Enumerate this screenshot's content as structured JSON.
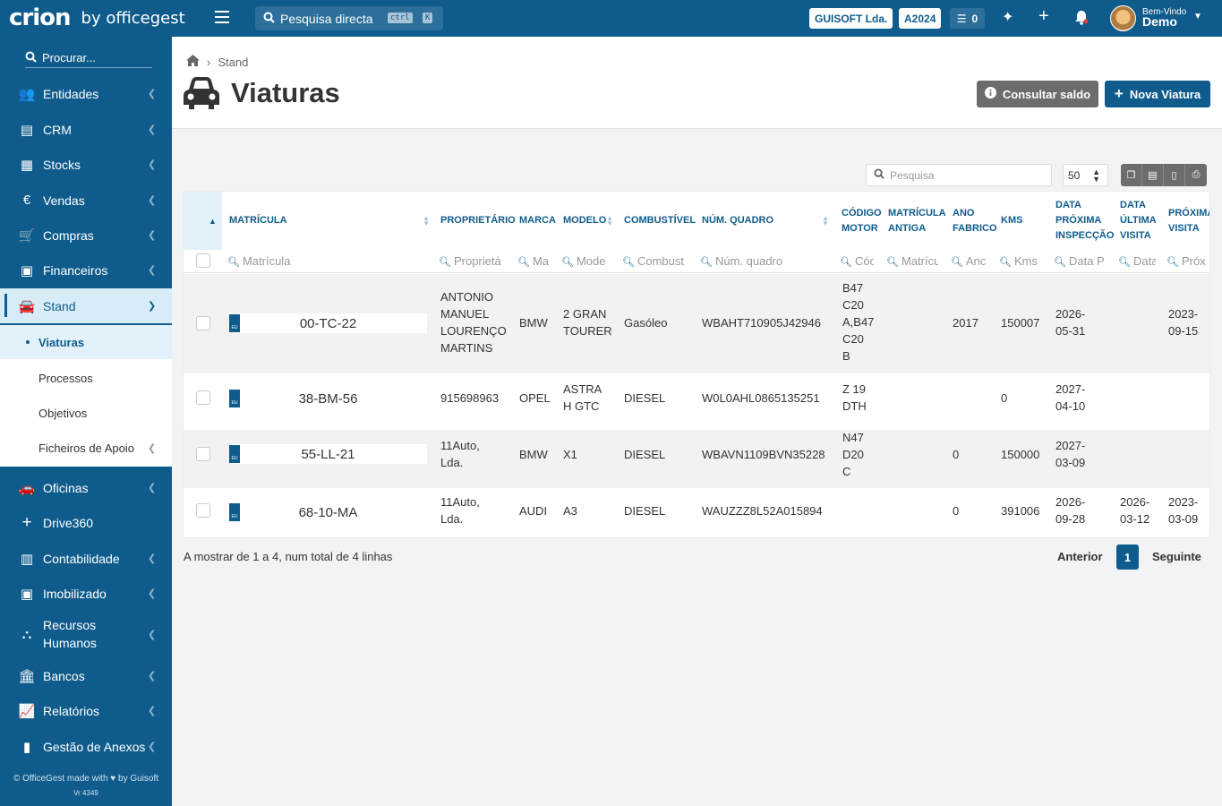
{
  "topbar": {
    "logo": "crion",
    "logo_by": "by officegest",
    "quick_search_placeholder": "Pesquisa directa",
    "kbd_ctrl": "ctrl",
    "kbd_k": "K",
    "company": "GUISOFT Lda.",
    "year": "A2024",
    "tasks_count": "0",
    "welcome_line1": "Bem-Vindo",
    "welcome_line2": "Demo",
    "icons": [
      "menu-icon",
      "search-icon",
      "tasks-icon",
      "sparkle-icon",
      "plus-icon",
      "bell-icon",
      "chevron-down-icon"
    ],
    "brand_color": "#0f5c8c"
  },
  "sidebar": {
    "search_placeholder": "Procurar...",
    "items": [
      {
        "label": "Entidades",
        "icon": "users-icon"
      },
      {
        "label": "CRM",
        "icon": "address-book-icon"
      },
      {
        "label": "Stocks",
        "icon": "warehouse-icon"
      },
      {
        "label": "Vendas",
        "icon": "euro-icon"
      },
      {
        "label": "Compras",
        "icon": "cart-icon"
      },
      {
        "label": "Financeiros",
        "icon": "money-icon"
      },
      {
        "label": "Stand",
        "icon": "cars-icon"
      },
      {
        "label": "Oficinas",
        "icon": "car-icon"
      },
      {
        "label": "Drive360",
        "icon": "plus-icon"
      },
      {
        "label": "Contabilidade",
        "icon": "calculator-icon"
      },
      {
        "label": "Imobilizado",
        "icon": "cash-icon"
      },
      {
        "label": "Recursos Humanos",
        "icon": "org-chart-icon"
      },
      {
        "label": "Bancos",
        "icon": "bank-icon"
      },
      {
        "label": "Relatórios",
        "icon": "chart-icon"
      },
      {
        "label": "Gestão de Anexos",
        "icon": "file-icon"
      }
    ],
    "sub_items": [
      {
        "label": "Viaturas"
      },
      {
        "label": "Processos"
      },
      {
        "label": "Objetivos"
      },
      {
        "label": "Ficheiros de Apoio"
      }
    ],
    "footer": "© OfficeGest made with ♥ by Guisoft",
    "version": "Vr 4349"
  },
  "page": {
    "breadcrumb": "Stand",
    "title": "Viaturas",
    "btn_saldo": "Consultar saldo",
    "btn_nova": "Nova Viatura"
  },
  "table": {
    "search_placeholder": "Pesquisa",
    "page_size": "50",
    "headers": [
      {
        "l1": "MATRÍCULA",
        "l2": "",
        "l3": ""
      },
      {
        "l1": "PROPRIETÁRIO",
        "l2": "",
        "l3": ""
      },
      {
        "l1": "MARCA",
        "l2": "",
        "l3": ""
      },
      {
        "l1": "MODELO",
        "l2": "",
        "l3": ""
      },
      {
        "l1": "COMBUSTÍVEL",
        "l2": "",
        "l3": ""
      },
      {
        "l1": "NÚM. QUADRO",
        "l2": "",
        "l3": ""
      },
      {
        "l1": "CÓDIGO",
        "l2": "MOTOR",
        "l3": ""
      },
      {
        "l1": "MATRÍCULA",
        "l2": "ANTIGA",
        "l3": ""
      },
      {
        "l1": "ANO",
        "l2": "FABRICO",
        "l3": ""
      },
      {
        "l1": "KMS",
        "l2": "",
        "l3": ""
      },
      {
        "l1": "DATA",
        "l2": "PRÓXIMA",
        "l3": "INSPECÇÃO"
      },
      {
        "l1": "DATA",
        "l2": "ÚLTIMA",
        "l3": "VISITA"
      },
      {
        "l1": "PRÓXIMA",
        "l2": "VISITA",
        "l3": ""
      }
    ],
    "filters": [
      "Matrícula",
      "Proprietá",
      "Ma",
      "Mode",
      "Combust",
      "Núm. quadro",
      "Cóc",
      "Matrícu",
      "Anc",
      "Kms",
      "Data P",
      "Data",
      "Próx"
    ],
    "rows": [
      {
        "plate": "00-TC-22",
        "eu": "EU",
        "owner": [
          "ANTONIO",
          "MANUEL",
          "LOURENÇO",
          "MARTINS"
        ],
        "brand": "BMW",
        "model": [
          "2 GRAN",
          "TOURER"
        ],
        "fuel": "Gasóleo",
        "vin": "WBAHT710905J42946",
        "engine": [
          "B47",
          "C20",
          "A,B47",
          "C20",
          "B"
        ],
        "old_plate": "",
        "year": "2017",
        "kms": "150007",
        "next_insp": [
          "2026-",
          "05-31"
        ],
        "last_visit": [
          "",
          ""
        ],
        "next_visit": [
          "2023-",
          "09-15"
        ]
      },
      {
        "plate": "38-BM-56",
        "eu": "EU",
        "owner": [
          "915698963"
        ],
        "brand": "OPEL",
        "model": [
          "ASTRA",
          "H GTC"
        ],
        "fuel": "DIESEL",
        "vin": "W0L0AHL0865135251",
        "engine": [
          "Z 19",
          "DTH"
        ],
        "old_plate": "",
        "year": "",
        "kms": "0",
        "next_insp": [
          "2027-",
          "04-10"
        ],
        "last_visit": [
          "",
          ""
        ],
        "next_visit": [
          "",
          ""
        ]
      },
      {
        "plate": "55-LL-21",
        "eu": "EU",
        "owner": [
          "11Auto,",
          "Lda."
        ],
        "brand": "BMW",
        "model": [
          "X1"
        ],
        "fuel": "DIESEL",
        "vin": "WBAVN1109BVN35228",
        "engine": [
          "N47",
          "D20",
          "C"
        ],
        "old_plate": "",
        "year": "0",
        "kms": "150000",
        "next_insp": [
          "2027-",
          "03-09"
        ],
        "last_visit": [
          "",
          ""
        ],
        "next_visit": [
          "",
          ""
        ]
      },
      {
        "plate": "68-10-MA",
        "eu": "EU",
        "owner": [
          "11Auto,",
          "Lda."
        ],
        "brand": "AUDI",
        "model": [
          "A3"
        ],
        "fuel": "DIESEL",
        "vin": "WAUZZZ8L52A015894",
        "engine": [
          ""
        ],
        "old_plate": "",
        "year": "0",
        "kms": "391006",
        "next_insp": [
          "2026-",
          "09-28"
        ],
        "last_visit": [
          "2026-",
          "03-12"
        ],
        "next_visit": [
          "2023-",
          "03-09"
        ]
      }
    ],
    "summary": "A mostrar de 1 a 4, num total de 4 linhas",
    "prev": "Anterior",
    "page": "1",
    "next": "Seguinte"
  }
}
